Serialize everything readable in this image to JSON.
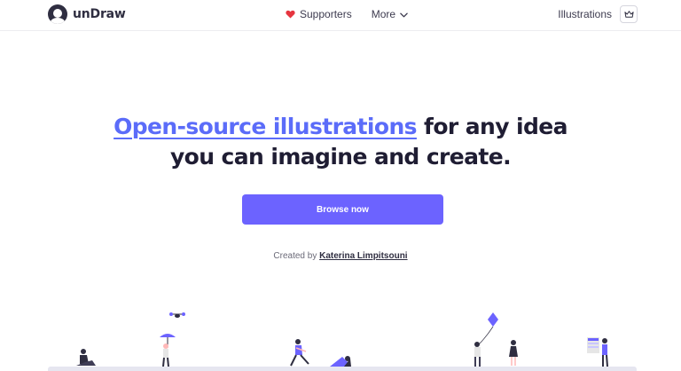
{
  "header": {
    "brand": "unDraw",
    "nav": {
      "supporters": "Supporters",
      "more": "More"
    },
    "illustrations": "Illustrations"
  },
  "hero": {
    "title_highlight": "Open-source illustrations",
    "title_rest_line1": " for any idea",
    "title_line2": "you can imagine and create.",
    "cta": "Browse now"
  },
  "credit": {
    "prefix": "Created by ",
    "author": "Katerina Limpitsouni"
  },
  "colors": {
    "accent": "#6c63ff",
    "highlight_text": "#5b6cf9",
    "heart": "#e6353f",
    "dark": "#2f2e41"
  },
  "icons": [
    "logo-icon",
    "heart-icon",
    "chevron-down-icon",
    "crown-icon"
  ]
}
